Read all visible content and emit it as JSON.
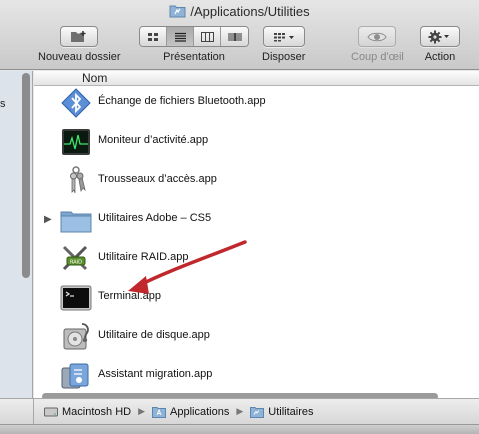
{
  "window": {
    "title": "/Applications/Utilities"
  },
  "toolbar": {
    "new_folder_label": "Nouveau dossier",
    "view_label": "Présentation",
    "arrange_label": "Disposer",
    "quicklook_label": "Coup d'œil",
    "action_label": "Action"
  },
  "sidebar": {
    "partial_text": "s"
  },
  "list": {
    "column_name": "Nom",
    "items": [
      {
        "name": "Échange de fichiers Bluetooth.app",
        "icon": "bluetooth-exchange-icon"
      },
      {
        "name": "Moniteur d’activité.app",
        "icon": "activity-monitor-icon"
      },
      {
        "name": "Trousseaux d’accès.app",
        "icon": "keychain-icon"
      },
      {
        "name": "Utilitaires Adobe – CS5",
        "icon": "folder-icon",
        "expandable": true
      },
      {
        "name": "Utilitaire RAID.app",
        "icon": "raid-utility-icon"
      },
      {
        "name": "Terminal.app",
        "icon": "terminal-icon"
      },
      {
        "name": "Utilitaire de disque.app",
        "icon": "disk-utility-icon"
      },
      {
        "name": "Assistant migration.app",
        "icon": "migration-assistant-icon"
      }
    ]
  },
  "pathbar": {
    "segments": [
      "Macintosh HD",
      "Applications",
      "Utilitaires"
    ]
  },
  "colors": {
    "annotation_arrow": "#c0282d",
    "folder_blue": "#8fb3d6"
  }
}
